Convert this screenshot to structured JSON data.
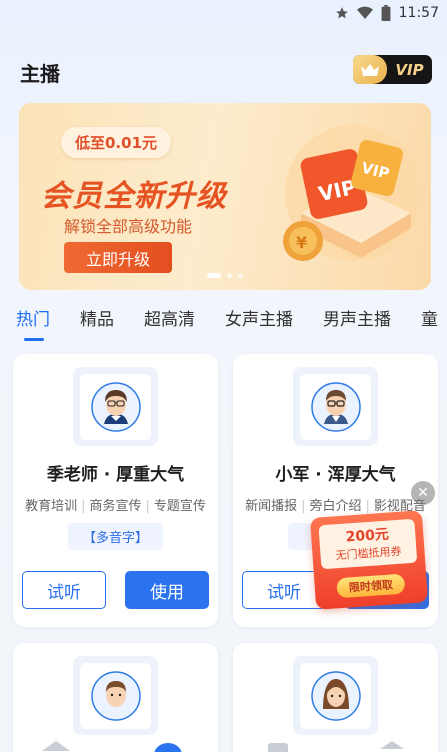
{
  "status_bar": {
    "time": "11:57"
  },
  "header": {
    "title": "主播",
    "vip_label": "VIP"
  },
  "banner": {
    "price_pill": "低至0.01元",
    "headline": "会员全新升级",
    "subtitle": "解锁全部高级功能",
    "cta": "立即升级",
    "slide_count": 3,
    "active_slide": 1
  },
  "tabs": [
    "热门",
    "精品",
    "超高清",
    "女声主播",
    "男声主播",
    "童"
  ],
  "active_tab": "热门",
  "cards": [
    {
      "name": "季老师 · 厚重大气",
      "tags": [
        "教育培训",
        "商务宣传",
        "专题宣传"
      ],
      "feature": "【多音字】",
      "listen_label": "试听",
      "use_label": "使用"
    },
    {
      "name": "小军 · 浑厚大气",
      "tags": [
        "新闻播报",
        "旁白介绍",
        "影视配音"
      ],
      "feature": "【多音字】",
      "listen_label": "试听",
      "use_label": "使用"
    }
  ],
  "coupon": {
    "amount": "200元",
    "description": "无门槛抵用券",
    "button": "限时领取"
  },
  "colors": {
    "accent": "#2a72ee",
    "banner_orange": "#e65322",
    "vip_gold": "#f4d08c"
  }
}
